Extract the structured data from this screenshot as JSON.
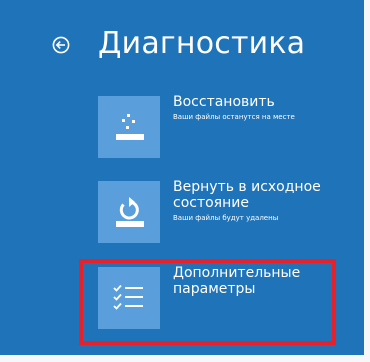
{
  "header": {
    "title": "Диагностика"
  },
  "options": [
    {
      "label": "Восстановить",
      "desc": "Ваши файлы останутся на месте",
      "icon": "restore-icon"
    },
    {
      "label": "Вернуть в исходное состояние",
      "desc": "Ваши файлы будут удалены",
      "icon": "reset-icon"
    },
    {
      "label": "Дополнительные параметры",
      "icon": "checklist-icon"
    }
  ],
  "colors": {
    "background": "#1f73b8",
    "tile": "#5a9fdb",
    "highlight": "#e8202a",
    "text": "#ffffff"
  }
}
